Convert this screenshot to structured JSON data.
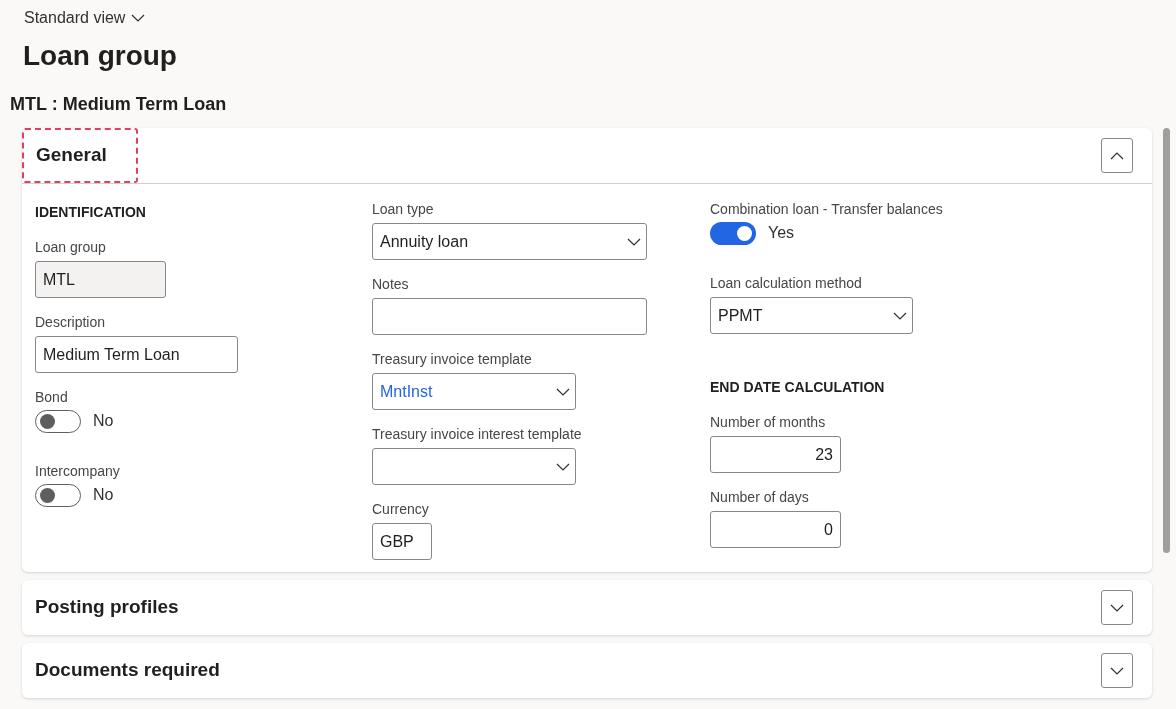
{
  "view_selector": {
    "label": "Standard view"
  },
  "page_title": "Loan group",
  "record_title": "MTL : Medium Term Loan",
  "sections": [
    {
      "title": "General",
      "expanded": true,
      "highlighted": true,
      "columns": [
        [
          {
            "kind": "heading",
            "label": "IDENTIFICATION"
          },
          {
            "kind": "text",
            "label": "Loan group",
            "value": "MTL",
            "disabled": true
          },
          {
            "kind": "text",
            "label": "Description",
            "value": "Medium Term Loan",
            "disabled": false
          },
          {
            "kind": "toggle",
            "label": "Bond",
            "on": false,
            "value": "No"
          },
          {
            "kind": "toggle",
            "label": "Intercompany",
            "on": false,
            "value": "No"
          }
        ],
        [
          {
            "kind": "dropdown",
            "label": "Loan type",
            "value": "Annuity loan",
            "link": false
          },
          {
            "kind": "text",
            "label": "Notes",
            "disabled": false
          },
          {
            "kind": "dropdown",
            "label": "Treasury invoice template",
            "value": "MntInst",
            "link": true
          },
          {
            "kind": "dropdown",
            "label": "Treasury invoice interest template"
          },
          {
            "kind": "text",
            "label": "Currency",
            "value": "GBP",
            "disabled": false
          }
        ],
        [
          {
            "kind": "toggle",
            "label": "Combination loan - Transfer balances",
            "on": true,
            "value": "Yes"
          },
          {
            "kind": "dropdown",
            "label": "Loan calculation method",
            "value": "PPMT",
            "link": false
          },
          {
            "kind": "heading",
            "label": "END DATE CALCULATION"
          },
          {
            "kind": "number",
            "label": "Number of months",
            "value": "23"
          },
          {
            "kind": "number",
            "label": "Number of days",
            "value": "0"
          }
        ]
      ]
    },
    {
      "title": "Posting profiles",
      "expanded": false,
      "highlighted": false
    },
    {
      "title": "Documents required",
      "expanded": false,
      "highlighted": false
    }
  ]
}
